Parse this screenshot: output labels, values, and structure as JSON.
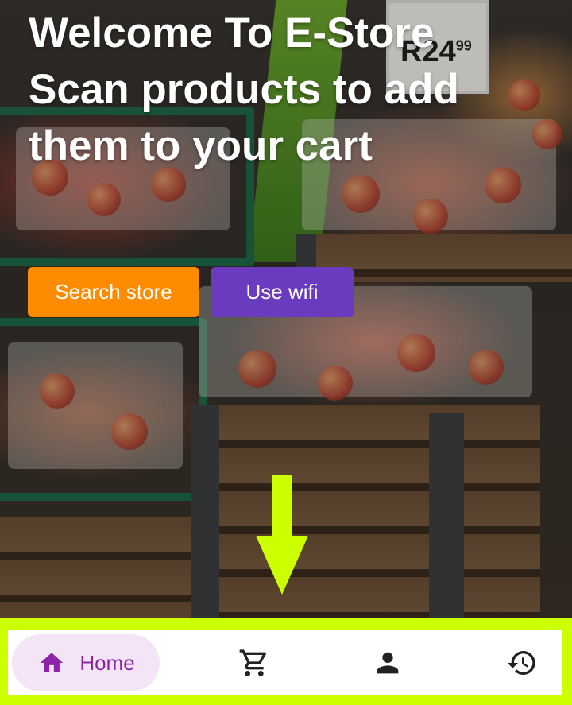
{
  "header": {
    "line1": "Welcome To E-Store",
    "line2": "Scan products to add",
    "line3": "them to your cart"
  },
  "actions": {
    "search_label": "Search store",
    "wifi_label": "Use wifi"
  },
  "background": {
    "price_sign": "R24",
    "price_cents": "99"
  },
  "bottom_nav": {
    "items": [
      {
        "label": "Home",
        "icon": "home-icon",
        "active": true
      },
      {
        "label": "",
        "icon": "cart-icon",
        "active": false
      },
      {
        "label": "",
        "icon": "person-icon",
        "active": false
      },
      {
        "label": "",
        "icon": "history-icon",
        "active": false
      }
    ]
  },
  "colors": {
    "search_button": "#ff8c00",
    "wifi_button": "#6a3bbf",
    "nav_active_bg": "#f3e5f6",
    "nav_active_fg": "#8e24aa",
    "highlight": "#ccff00"
  }
}
